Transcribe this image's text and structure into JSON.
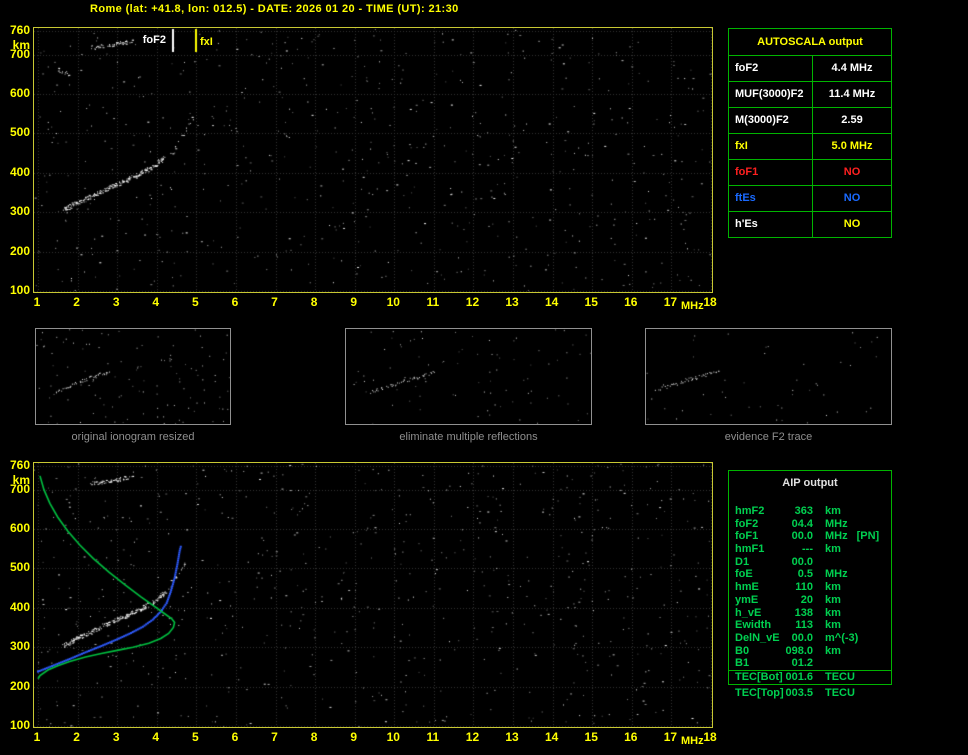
{
  "header": {
    "title": "Rome (lat: +41.8, lon: 012.5) - DATE: 2026 01 20 - TIME (UT): 21:30"
  },
  "colors": {
    "background": "#000000",
    "axis_text": "#ffff00",
    "plot_border": "#c8c832",
    "grid": "#343434",
    "table_border": "#00b400",
    "aip_text": "#00d050",
    "trace": "#ffffff",
    "profile_green": "#00c040",
    "restored_blue": "#2e5bff",
    "alert_red": "#ff2020",
    "alert_blue": "#1a6aff"
  },
  "chart_data": [
    {
      "id": "main-ionogram",
      "type": "scatter",
      "xlabel": "MHz",
      "ylabel": "km",
      "xlim": [
        1,
        18
      ],
      "ylim": [
        100,
        760
      ],
      "grid": true,
      "x_ticks": [
        1,
        2,
        3,
        4,
        5,
        6,
        7,
        8,
        9,
        10,
        11,
        12,
        13,
        14,
        15,
        16,
        17,
        18
      ],
      "y_ticks": [
        760,
        700,
        600,
        500,
        400,
        300,
        200,
        100
      ],
      "seed": 101,
      "noise_dots": 620,
      "markers": [
        {
          "label": "foF2",
          "x": 4.4,
          "color": "#ffffff"
        },
        {
          "label": "fxI",
          "x": 5.0,
          "color": "#ffff00"
        }
      ],
      "series": [
        {
          "name": "F2-echo-trace",
          "color": "#ffffff",
          "style": "dots",
          "density": 3,
          "skip": 0.1,
          "points": [
            [
              1.65,
              308
            ],
            [
              1.85,
              318
            ],
            [
              2.05,
              328
            ],
            [
              2.3,
              340
            ],
            [
              2.55,
              352
            ],
            [
              2.8,
              363
            ],
            [
              3.05,
              374
            ],
            [
              3.3,
              386
            ],
            [
              3.55,
              398
            ],
            [
              3.75,
              408
            ],
            [
              3.95,
              420
            ],
            [
              4.1,
              432
            ],
            [
              4.2,
              442
            ]
          ]
        },
        {
          "name": "F2-cusp",
          "color": "#ffffff",
          "style": "dots",
          "density": 1,
          "skip": 0.45,
          "points": [
            [
              4.35,
              448
            ],
            [
              4.5,
              470
            ],
            [
              4.65,
              495
            ],
            [
              4.8,
              520
            ],
            [
              4.95,
              545
            ]
          ]
        },
        {
          "name": "second-hop-echo",
          "color": "#ffffff",
          "style": "dots",
          "density": 2,
          "skip": 0.2,
          "points": [
            [
              2.35,
              718
            ],
            [
              2.7,
              724
            ],
            [
              3.1,
              730
            ],
            [
              3.45,
              736
            ]
          ]
        },
        {
          "name": "echo-fragment",
          "color": "#ffffff",
          "style": "dots",
          "density": 2,
          "skip": 0.2,
          "points": [
            [
              1.5,
              662
            ],
            [
              1.65,
              656
            ],
            [
              1.8,
              650
            ]
          ]
        }
      ]
    },
    {
      "id": "scaled-ionogram-with-profile",
      "type": "scatter",
      "xlabel": "MHz",
      "ylabel": "km",
      "xlim": [
        1,
        18
      ],
      "ylim": [
        100,
        760
      ],
      "grid": true,
      "x_ticks": [
        1,
        2,
        3,
        4,
        5,
        6,
        7,
        8,
        9,
        10,
        11,
        12,
        13,
        14,
        15,
        16,
        17,
        18
      ],
      "y_ticks": [
        760,
        700,
        600,
        500,
        400,
        300,
        200,
        100
      ],
      "seed": 202,
      "noise_dots": 680,
      "markers": [],
      "series": [
        {
          "name": "F2-echo-trace",
          "color": "#ffffff",
          "style": "dots",
          "density": 3,
          "skip": 0.1,
          "points": [
            [
              1.65,
              305
            ],
            [
              1.85,
              316
            ],
            [
              2.05,
              327
            ],
            [
              2.3,
              339
            ],
            [
              2.55,
              351
            ],
            [
              2.8,
              362
            ],
            [
              3.05,
              373
            ],
            [
              3.3,
              385
            ],
            [
              3.55,
              397
            ],
            [
              3.75,
              407
            ],
            [
              3.95,
              419
            ],
            [
              4.1,
              431
            ],
            [
              4.22,
              443
            ]
          ]
        },
        {
          "name": "F2-cusp",
          "color": "#ffffff",
          "style": "dots",
          "density": 1,
          "skip": 0.45,
          "points": [
            [
              4.32,
              450
            ],
            [
              4.45,
              472
            ],
            [
              4.6,
              498
            ],
            [
              4.75,
              522
            ]
          ]
        },
        {
          "name": "second-hop-echo",
          "color": "#ffffff",
          "style": "dots",
          "density": 2,
          "skip": 0.2,
          "points": [
            [
              2.35,
              716
            ],
            [
              2.7,
              722
            ],
            [
              3.1,
              728
            ],
            [
              3.4,
              733
            ]
          ]
        },
        {
          "name": "restored-F2-trace",
          "color": "#2e5bff",
          "style": "dotline",
          "points": [
            [
              1.0,
              238
            ],
            [
              1.4,
              254
            ],
            [
              1.8,
              270
            ],
            [
              2.2,
              287
            ],
            [
              2.6,
              303
            ],
            [
              3.0,
              320
            ],
            [
              3.35,
              336
            ],
            [
              3.65,
              352
            ],
            [
              3.9,
              370
            ],
            [
              4.1,
              390
            ],
            [
              4.25,
              412
            ],
            [
              4.35,
              440
            ],
            [
              4.45,
              475
            ],
            [
              4.52,
              510
            ],
            [
              4.58,
              545
            ],
            [
              4.62,
              560
            ]
          ]
        },
        {
          "name": "electron-density-profile",
          "color": "#00c040",
          "style": "line",
          "points": [
            [
              1.05,
              735
            ],
            [
              1.15,
              700
            ],
            [
              1.3,
              665
            ],
            [
              1.5,
              630
            ],
            [
              1.75,
              595
            ],
            [
              2.05,
              560
            ],
            [
              2.4,
              525
            ],
            [
              2.8,
              490
            ],
            [
              3.2,
              458
            ],
            [
              3.6,
              428
            ],
            [
              3.95,
              403
            ],
            [
              4.2,
              385
            ],
            [
              4.38,
              372
            ],
            [
              4.45,
              363
            ],
            [
              4.42,
              350
            ],
            [
              4.3,
              335
            ],
            [
              4.1,
              322
            ],
            [
              3.8,
              310
            ],
            [
              3.4,
              300
            ],
            [
              3.0,
              292
            ],
            [
              2.6,
              284
            ],
            [
              2.2,
              275
            ],
            [
              1.8,
              264
            ],
            [
              1.5,
              253
            ],
            [
              1.25,
              242
            ],
            [
              1.05,
              228
            ],
            [
              1.0,
              220
            ]
          ]
        }
      ]
    }
  ],
  "thumbnails": [
    {
      "caption": "original ionogram resized",
      "seed": 7,
      "noise_dots": 120,
      "trace": [
        [
          0.1,
          0.66
        ],
        [
          0.17,
          0.6
        ],
        [
          0.24,
          0.54
        ],
        [
          0.31,
          0.49
        ],
        [
          0.38,
          0.44
        ]
      ]
    },
    {
      "caption": "eliminate multiple reflections",
      "seed": 8,
      "noise_dots": 85,
      "trace": [
        [
          0.1,
          0.66
        ],
        [
          0.16,
          0.61
        ],
        [
          0.23,
          0.55
        ],
        [
          0.3,
          0.5
        ],
        [
          0.36,
          0.45
        ]
      ]
    },
    {
      "caption": "evidence F2 trace",
      "seed": 9,
      "noise_dots": 50,
      "trace": [
        [
          0.04,
          0.64
        ],
        [
          0.1,
          0.59
        ],
        [
          0.17,
          0.53
        ],
        [
          0.24,
          0.48
        ],
        [
          0.3,
          0.44
        ]
      ]
    }
  ],
  "autoscala": {
    "title": "AUTOSCALA output",
    "rows": [
      {
        "param": "foF2",
        "value": "4.4 MHz",
        "color": "#ffffff"
      },
      {
        "param": "MUF(3000)F2",
        "value": "11.4 MHz",
        "color": "#ffffff"
      },
      {
        "param": "M(3000)F2",
        "value": "2.59",
        "color": "#ffffff"
      },
      {
        "param": "fxI",
        "value": "5.0 MHz",
        "color": "#ffff00"
      },
      {
        "param": "foF1",
        "value": "NO",
        "color": "#ff2020"
      },
      {
        "param": "ftEs",
        "value": "NO",
        "color": "#1a6aff"
      },
      {
        "param": "h'Es",
        "value": "NO",
        "color": "#ffffff",
        "value_color": "#ffff00"
      }
    ]
  },
  "aip": {
    "title": "AIP output",
    "rows": [
      {
        "param": "hmF2",
        "value": "363",
        "unit": "km"
      },
      {
        "param": "foF2",
        "value": "04.4",
        "unit": "MHz"
      },
      {
        "param": "foF1",
        "value": "00.0",
        "unit": "MHz",
        "note": "[PN]"
      },
      {
        "param": "hmF1",
        "value": "---",
        "unit": "km"
      },
      {
        "param": "D1",
        "value": "00.0",
        "unit": ""
      },
      {
        "param": "foE",
        "value": "0.5",
        "unit": "MHz"
      },
      {
        "param": "hmE",
        "value": "110",
        "unit": "km"
      },
      {
        "param": "ymE",
        "value": "20",
        "unit": "km"
      },
      {
        "param": "h_vE",
        "value": "138",
        "unit": "km"
      },
      {
        "param": "Ewidth",
        "value": "113",
        "unit": "km"
      },
      {
        "param": "DelN_vE",
        "value": "00.0",
        "unit": "m^(-3)"
      },
      {
        "param": "B0",
        "value": "098.0",
        "unit": "km"
      },
      {
        "param": "B1",
        "value": "01.2",
        "unit": ""
      }
    ],
    "tec_rows": [
      {
        "param": "TEC[Bot]",
        "value": "001.6",
        "unit": "TECU"
      },
      {
        "param": "TEC[Top]",
        "value": "003.5",
        "unit": "TECU"
      }
    ]
  }
}
